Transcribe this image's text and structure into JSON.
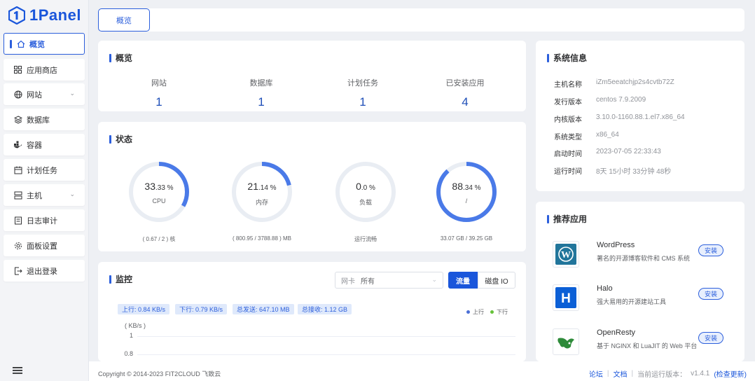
{
  "app": {
    "logo_text": "1Panel"
  },
  "sidebar": {
    "items": [
      {
        "label": "概览",
        "icon": "home-icon"
      },
      {
        "label": "应用商店",
        "icon": "app-store-icon"
      },
      {
        "label": "网站",
        "icon": "globe-icon"
      },
      {
        "label": "数据库",
        "icon": "database-icon"
      },
      {
        "label": "容器",
        "icon": "container-icon"
      },
      {
        "label": "计划任务",
        "icon": "calendar-icon"
      },
      {
        "label": "主机",
        "icon": "host-icon"
      },
      {
        "label": "日志审计",
        "icon": "log-icon"
      },
      {
        "label": "面板设置",
        "icon": "gear-icon"
      },
      {
        "label": "退出登录",
        "icon": "logout-icon"
      }
    ]
  },
  "tabs": {
    "active": "概览"
  },
  "overview": {
    "title": "概览",
    "stats": [
      {
        "label": "网站",
        "value": "1"
      },
      {
        "label": "数据库",
        "value": "1"
      },
      {
        "label": "计划任务",
        "value": "1"
      },
      {
        "label": "已安装应用",
        "value": "4"
      }
    ]
  },
  "status": {
    "title": "状态",
    "gauges": [
      {
        "int": "33",
        "dec": ".33 %",
        "percent": 33.33,
        "name": "CPU",
        "foot": "( 0.67 / 2 ) 核"
      },
      {
        "int": "21",
        "dec": ".14 %",
        "percent": 21.14,
        "name": "内存",
        "foot": "( 800.95 / 3788.88 ) MB"
      },
      {
        "int": "0",
        "dec": ".0 %",
        "percent": 0,
        "name": "负载",
        "foot": "运行流畅"
      },
      {
        "int": "88",
        "dec": ".34 %",
        "percent": 88.34,
        "name": "/",
        "foot": "33.07 GB / 39.25 GB"
      }
    ]
  },
  "monitor": {
    "title": "监控",
    "select_label": "网卡",
    "select_value": "所有",
    "seg_on": "流量",
    "seg_off": "磁盘 IO",
    "pills": [
      "上行: 0.84 KB/s",
      "下行: 0.79 KB/s",
      "总发送: 647.10 MB",
      "总接收: 1.12 GB"
    ],
    "legend": [
      {
        "label": "上行",
        "color": "#4b6fd6"
      },
      {
        "label": "下行",
        "color": "#67c23a"
      }
    ],
    "unit": "( KB/s )",
    "yticks": [
      "1",
      "0.8"
    ]
  },
  "sysinfo": {
    "title": "系统信息",
    "rows": [
      {
        "k": "主机名称",
        "v": "iZm5eeatchjp2s4cvtb72Z"
      },
      {
        "k": "发行版本",
        "v": "centos 7.9.2009"
      },
      {
        "k": "内核版本",
        "v": "3.10.0-1160.88.1.el7.x86_64"
      },
      {
        "k": "系统类型",
        "v": "x86_64"
      },
      {
        "k": "启动时间",
        "v": "2023-07-05 22:33:43"
      },
      {
        "k": "运行时间",
        "v": "8天 15小时 33分钟 48秒"
      }
    ]
  },
  "recommend": {
    "title": "推荐应用",
    "apps": [
      {
        "name": "WordPress",
        "desc": "著名的开源博客软件和 CMS 系统",
        "install": "安装",
        "icon": "wordpress-icon"
      },
      {
        "name": "Halo",
        "desc": "强大易用的开源建站工具",
        "install": "安装",
        "icon": "halo-icon"
      },
      {
        "name": "OpenResty",
        "desc": "基于 NGINX 和 LuaJIT 的 Web 平台",
        "install": "安装",
        "icon": "openresty-icon"
      }
    ]
  },
  "footer": {
    "copyright": "Copyright © 2014-2023 FIT2CLOUD 飞致云",
    "forum": "论坛",
    "docs": "文档",
    "version_label": "当前运行版本：",
    "version": "v1.4.1",
    "check_update": "(检查更新)"
  },
  "colors": {
    "accent": "#1a56db",
    "gauge_track": "#e9edf3"
  }
}
